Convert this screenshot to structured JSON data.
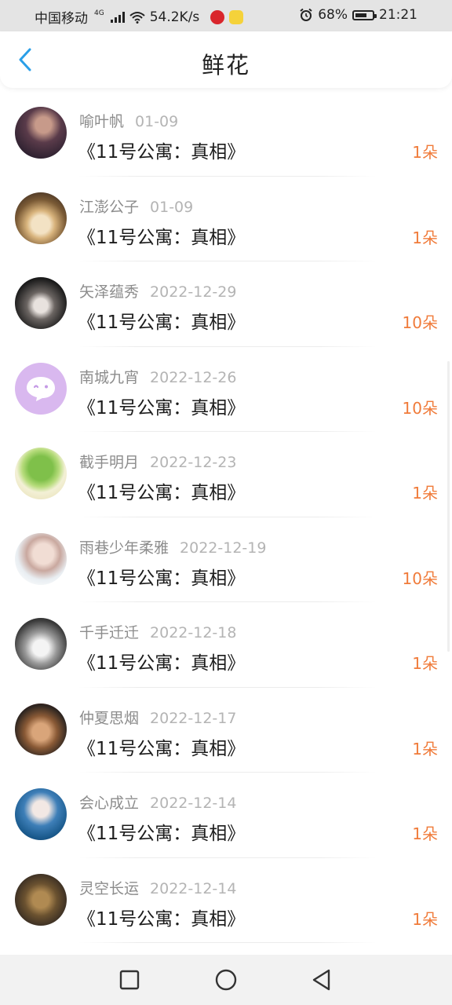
{
  "status_bar": {
    "carrier": "中国移动",
    "network": "4G",
    "speed": "54.2K/s",
    "battery": "68%",
    "battery_level": 0.68,
    "time": "21:21",
    "icons": [
      "signal-icon",
      "wifi-icon",
      "alarm-icon",
      "battery-icon"
    ]
  },
  "header": {
    "title": "鲜花",
    "back_icon": "chevron-left-icon"
  },
  "colors": {
    "accent": "#2a9fe8",
    "count_orange": "#f07b3a",
    "name_gray": "#8c8c8c",
    "date_gray": "#b4b4b4"
  },
  "list": [
    {
      "user": "喻叶帆",
      "date": "01-09",
      "book": "《11号公寓：真相》",
      "count": "1朵"
    },
    {
      "user": "江澎公子",
      "date": "01-09",
      "book": "《11号公寓：真相》",
      "count": "1朵"
    },
    {
      "user": "矢泽蕴秀",
      "date": "2022-12-29",
      "book": "《11号公寓：真相》",
      "count": "10朵"
    },
    {
      "user": "南城九宵",
      "date": "2022-12-26",
      "book": "《11号公寓：真相》",
      "count": "10朵"
    },
    {
      "user": "截手明月",
      "date": "2022-12-23",
      "book": "《11号公寓：真相》",
      "count": "1朵"
    },
    {
      "user": "雨巷少年柔雅",
      "date": "2022-12-19",
      "book": "《11号公寓：真相》",
      "count": "10朵"
    },
    {
      "user": "千手迁迁",
      "date": "2022-12-18",
      "book": "《11号公寓：真相》",
      "count": "1朵"
    },
    {
      "user": "仲夏思烟",
      "date": "2022-12-17",
      "book": "《11号公寓：真相》",
      "count": "1朵"
    },
    {
      "user": "会心成立",
      "date": "2022-12-14",
      "book": "《11号公寓：真相》",
      "count": "1朵"
    },
    {
      "user": "灵空长运",
      "date": "2022-12-14",
      "book": "《11号公寓：真相》",
      "count": "1朵"
    }
  ],
  "nav_bar": {
    "icons": [
      "recent-apps-icon",
      "home-icon",
      "back-icon"
    ]
  }
}
